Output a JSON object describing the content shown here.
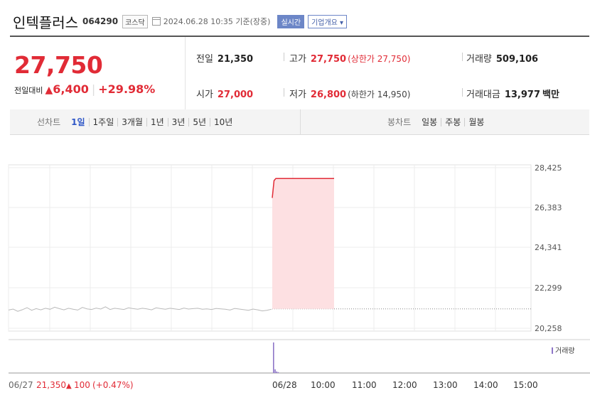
{
  "header": {
    "name": "인텍플러스",
    "code": "064290",
    "market_badge": "코스닥",
    "date_text": "2024.06.28 10:35 기준(장중)",
    "realtime_label": "실시간",
    "overview_label": "기업개요 ▾"
  },
  "quote": {
    "price": "27,750",
    "change_label": "전일대비",
    "change_arrow": "▲",
    "change_value": "6,400",
    "change_pct": "+29.98%",
    "prev_close_label": "전일",
    "prev_close": "21,350",
    "high_label": "고가",
    "high": "27,750",
    "upper_limit_text": "(상한가 27,750)",
    "volume_label": "거래량",
    "volume": "509,106",
    "open_label": "시가",
    "open": "27,000",
    "low_label": "저가",
    "low": "26,800",
    "lower_limit_text": "(하한가 14,950)",
    "amount_label": "거래대금",
    "amount": "13,977",
    "amount_unit": "백만"
  },
  "tabs": {
    "line_label": "선차트",
    "line_periods": [
      "1일",
      "1주일",
      "3개월",
      "1년",
      "3년",
      "5년",
      "10년"
    ],
    "active": "1일",
    "candle_label": "봉차트",
    "candle_periods": [
      "일봉",
      "주봉",
      "월봉"
    ]
  },
  "chart_data": {
    "type": "line",
    "title": "",
    "x_ticks": [
      "06/27",
      "06/28",
      "10:00",
      "11:00",
      "12:00",
      "13:00",
      "14:00",
      "15:00"
    ],
    "y_ticks": [
      "28,425",
      "26,383",
      "24,341",
      "22,299",
      "20,258"
    ],
    "ylim": [
      20258,
      28425
    ],
    "prev_close": 21350,
    "volume_legend": "거래량",
    "prev_day_caption": {
      "close": "21,350",
      "arrow": "▲",
      "change": "100",
      "pct": "(+0.47%)"
    },
    "series": [
      {
        "name": "06/27",
        "values": [
          21290,
          21340,
          21230,
          21310,
          21410,
          21280,
          21360,
          21300,
          21380,
          21330,
          21430,
          21360,
          21300,
          21380,
          21330,
          21290,
          21420,
          21350,
          21320,
          21390,
          21340,
          21450,
          21320,
          21380,
          21350,
          21320,
          21400,
          21360,
          21330,
          21380,
          21350,
          21300,
          21400,
          21360,
          21330,
          21380,
          21350,
          21320,
          21390,
          21340,
          21360,
          21380,
          21330,
          21350,
          21320,
          21370,
          21350,
          21330,
          21290,
          21370,
          21340,
          21310,
          21280,
          21340,
          21300,
          21250,
          21280,
          21330
        ]
      },
      {
        "name": "06/28",
        "values": [
          26800,
          27650,
          27750,
          27750,
          27750,
          27750,
          27750,
          27750,
          27750,
          27750,
          27750,
          27750,
          27750,
          27750,
          27750,
          27750,
          27750,
          27750,
          27750,
          27750,
          27750,
          27750,
          27750,
          27750,
          27750,
          27750,
          27750,
          27750,
          27750,
          27750,
          27750,
          27750,
          27750,
          27750,
          27750,
          27750
        ]
      }
    ],
    "volume_series": {
      "name": "06/28 거래량",
      "values": [
        1.0,
        0.12,
        0.05,
        0.03
      ]
    }
  },
  "colors": {
    "up": "#e12b36",
    "accent": "#2f57c7",
    "volume": "#8e76c8",
    "area": "#fde0e2"
  }
}
